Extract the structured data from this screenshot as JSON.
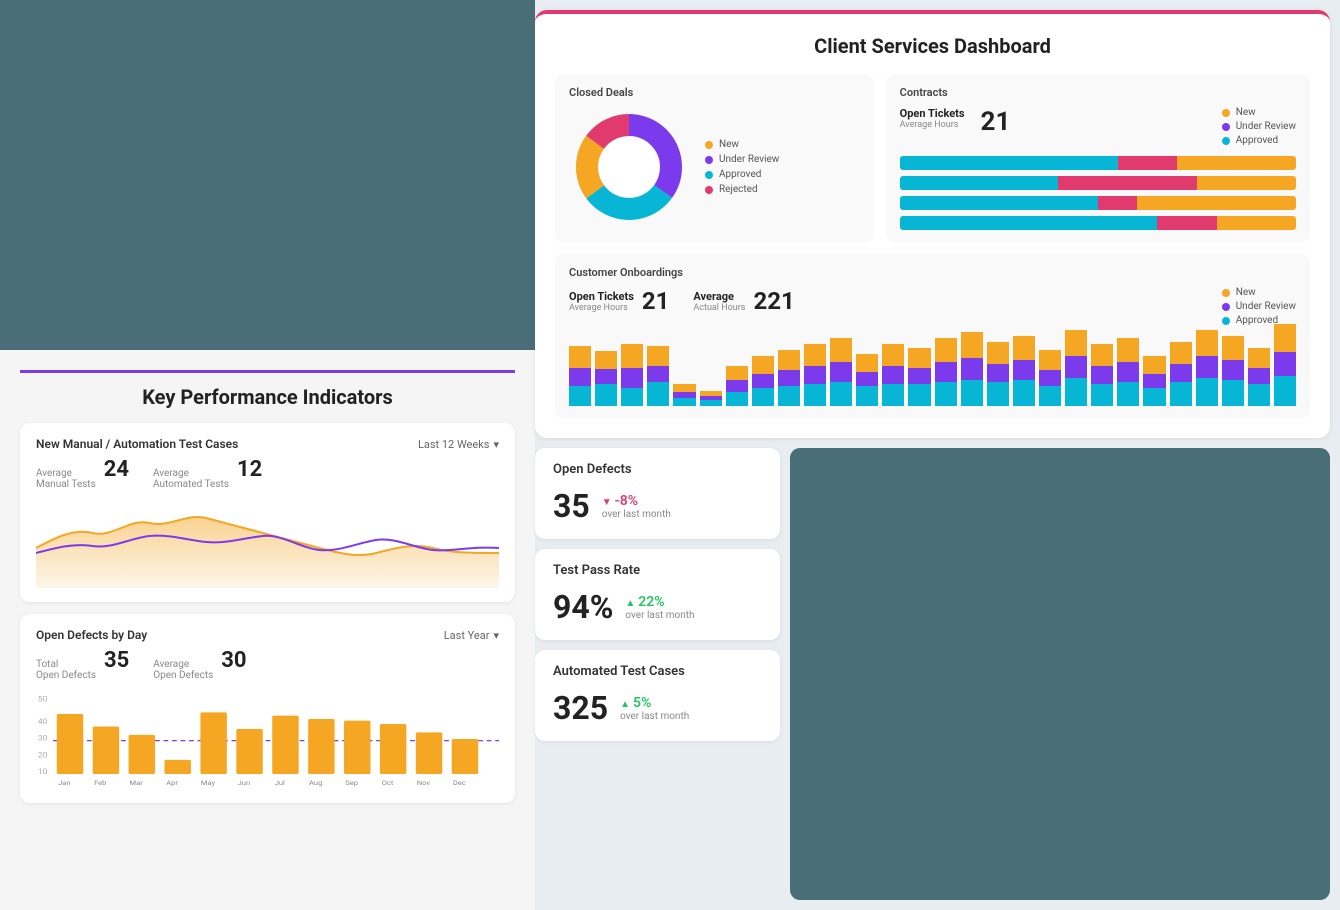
{
  "left": {
    "kpi": {
      "title": "Key Performance Indicators",
      "card1": {
        "title": "New Manual / Automation Test Cases",
        "filter": "Last 12 Weeks",
        "avg_manual_label": "Average",
        "avg_manual_sublabel": "Manual Tests",
        "avg_manual_value": "24",
        "avg_auto_label": "Average",
        "avg_auto_sublabel": "Automated Tests",
        "avg_auto_value": "12"
      },
      "card2": {
        "title": "Open Defects by Day",
        "filter": "Last Year",
        "total_label": "Total",
        "total_sublabel": "Open Defects",
        "total_value": "35",
        "avg_label": "Average",
        "avg_sublabel": "Open Defects",
        "avg_value": "30",
        "months": [
          "Jan",
          "Feb",
          "Mar",
          "Apr",
          "May",
          "Jun",
          "Jul",
          "Aug",
          "Sep",
          "Oct",
          "Nov",
          "Dec"
        ]
      }
    }
  },
  "right": {
    "dashboard": {
      "title": "Client Services Dashboard",
      "closed_deals": {
        "title": "Closed Deals",
        "legend": [
          {
            "label": "New",
            "color": "#f5a623"
          },
          {
            "label": "Under Review",
            "color": "#7c3aed"
          },
          {
            "label": "Approved",
            "color": "#06b6d4"
          },
          {
            "label": "Rejected",
            "color": "#e03a6e"
          }
        ]
      },
      "contracts": {
        "title": "Contracts",
        "open_tickets_label": "Open Tickets",
        "open_tickets_sublabel": "Average Hours",
        "open_tickets_value": "21",
        "legend": [
          {
            "label": "New",
            "color": "#f5a623"
          },
          {
            "label": "Under Review",
            "color": "#7c3aed"
          },
          {
            "label": "Approved",
            "color": "#06b6d4"
          }
        ],
        "bars": [
          {
            "cyan": 55,
            "pink": 15,
            "orange": 30
          },
          {
            "cyan": 40,
            "pink": 35,
            "orange": 25
          },
          {
            "cyan": 50,
            "pink": 10,
            "orange": 40
          },
          {
            "cyan": 60,
            "pink": 20,
            "orange": 20
          }
        ]
      },
      "customer_onboardings": {
        "title": "Customer Onboardings",
        "open_tickets_label": "Open Tickets",
        "open_tickets_sublabel": "Average Hours",
        "open_tickets_value": "21",
        "average_label": "Average",
        "average_sublabel": "Actual Hours",
        "average_value": "221",
        "legend": [
          {
            "label": "New",
            "color": "#f5a623"
          },
          {
            "label": "Under Review",
            "color": "#7c3aed"
          },
          {
            "label": "Approved",
            "color": "#06b6d4"
          }
        ]
      }
    },
    "stats": {
      "open_defects": {
        "title": "Open Defects",
        "value": "35",
        "change": "-8%",
        "change_dir": "down",
        "period": "over last month"
      },
      "test_pass_rate": {
        "title": "Test Pass Rate",
        "value": "94%",
        "change": "22%",
        "change_dir": "up",
        "period": "over last month"
      },
      "automated_test_cases": {
        "title": "Automated Test Cases",
        "value": "325",
        "change": "5%",
        "change_dir": "up",
        "period": "over last month"
      }
    }
  }
}
